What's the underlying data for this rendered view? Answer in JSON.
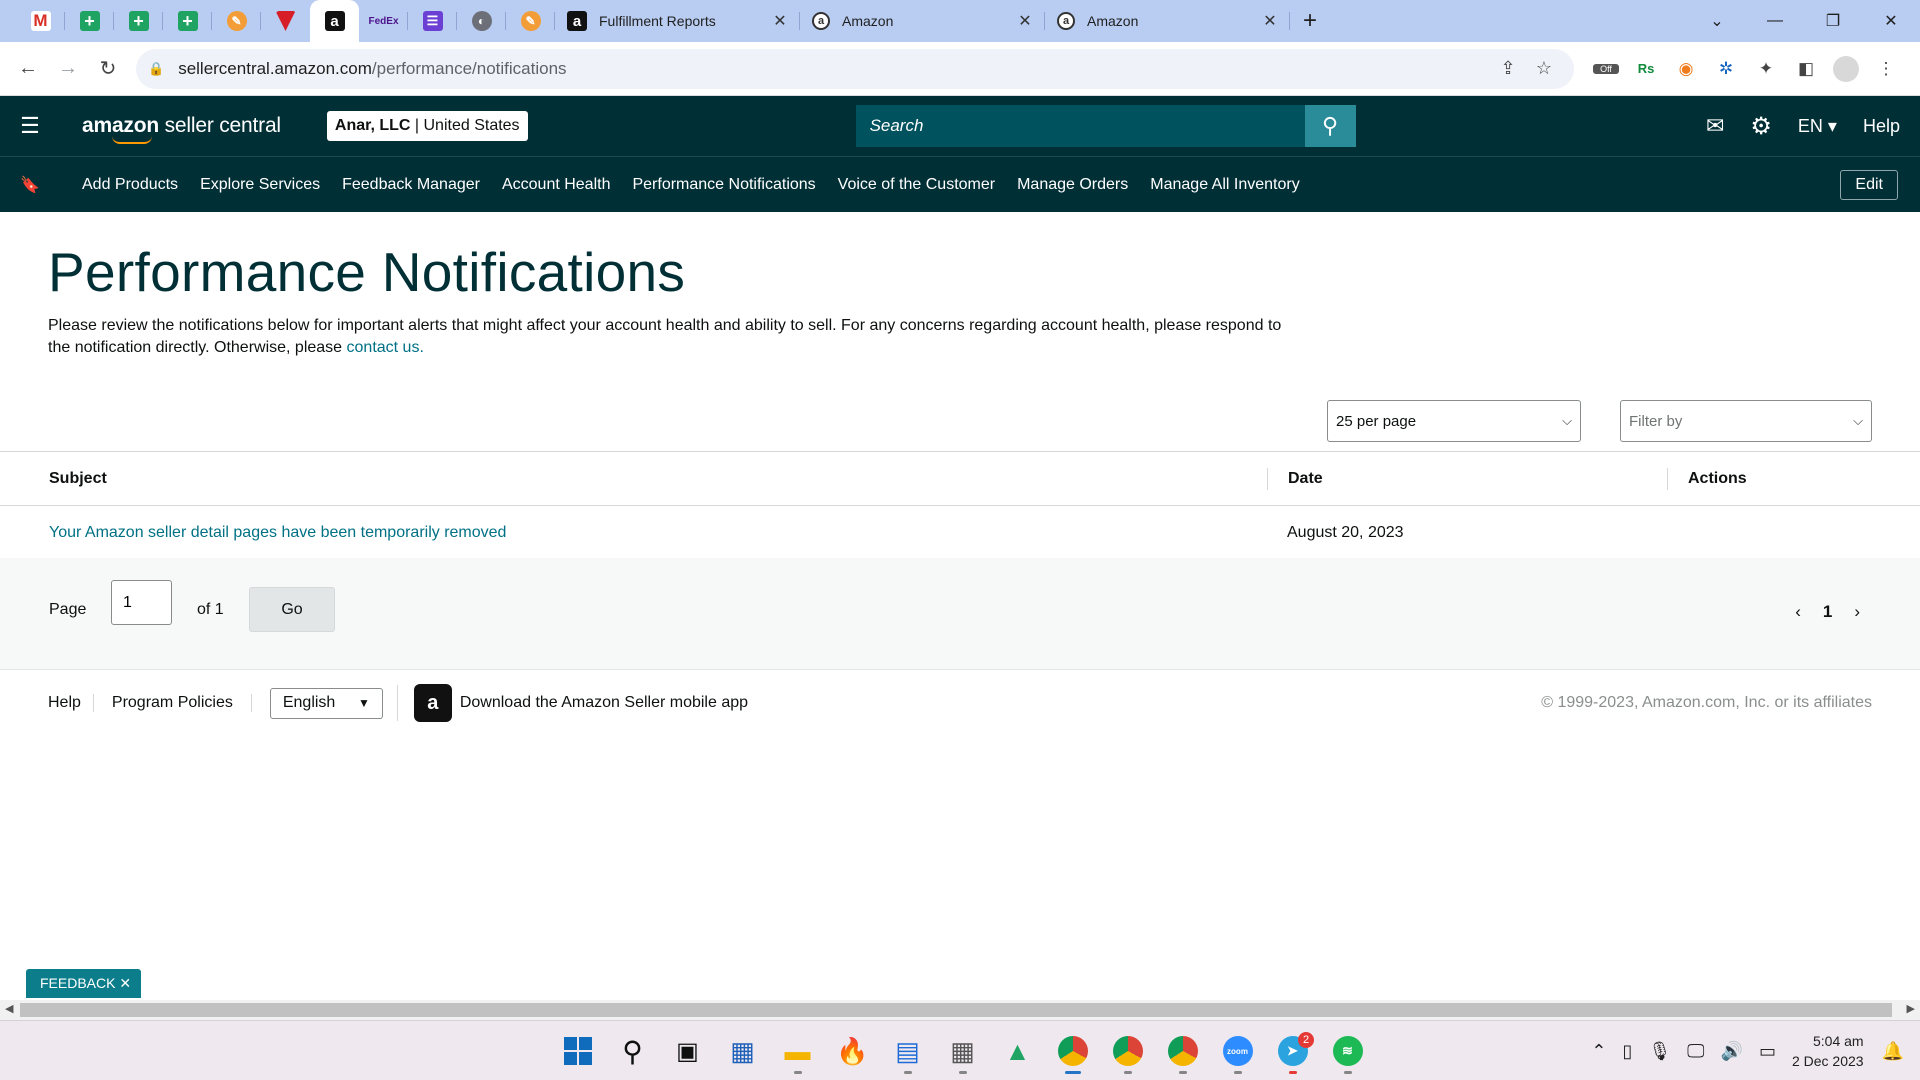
{
  "browser": {
    "pinned_tabs": [
      {
        "icon": "gmail-icon",
        "glyph": "M"
      },
      {
        "icon": "sheets-icon",
        "glyph": "+"
      },
      {
        "icon": "sheets-icon",
        "glyph": "+"
      },
      {
        "icon": "sheets-icon",
        "glyph": "+"
      },
      {
        "icon": "pencil-icon",
        "glyph": "✎"
      },
      {
        "icon": "shield-icon",
        "glyph": ""
      },
      {
        "icon": "amazon-icon",
        "glyph": "a"
      },
      {
        "icon": "fedex-icon",
        "glyph": "FedEx"
      },
      {
        "icon": "list-icon",
        "glyph": "☰"
      },
      {
        "icon": "globe-icon",
        "glyph": "◐"
      },
      {
        "icon": "pencil-icon",
        "glyph": "✎"
      }
    ],
    "tabs": [
      {
        "title": "Fulfillment Reports",
        "icon": "amazon-icon",
        "glyph": "a"
      },
      {
        "title": "Amazon",
        "icon": "amazon-circle-icon",
        "glyph": "a"
      },
      {
        "title": "Amazon",
        "icon": "amazon-circle-icon",
        "glyph": "a"
      }
    ],
    "url_host": "sellercentral.amazon.com",
    "url_path": "/performance/notifications"
  },
  "header": {
    "logo_bold": "amazon",
    "logo_rest": " seller central",
    "account_name": "Anar, LLC",
    "account_sep": " | ",
    "account_region": "United States",
    "search_placeholder": "Search",
    "language": "EN",
    "help": "Help"
  },
  "nav": {
    "links": [
      "Add Products",
      "Explore Services",
      "Feedback Manager",
      "Account Health",
      "Performance Notifications",
      "Voice of the Customer",
      "Manage Orders",
      "Manage All Inventory"
    ],
    "edit": "Edit"
  },
  "main": {
    "title": "Performance Notifications",
    "intro": "Please review the notifications below for important alerts that might affect your account health and ability to sell. For any concerns regarding account health, please respond to the notification directly. Otherwise, please ",
    "contact_link": "contact us.",
    "per_page": "25 per page",
    "filter_placeholder": "Filter by",
    "table": {
      "headers": {
        "subject": "Subject",
        "date": "Date",
        "actions": "Actions"
      },
      "rows": [
        {
          "subject": "Your Amazon seller detail pages have been temporarily removed",
          "date": "August 20, 2023",
          "actions": ""
        }
      ]
    },
    "pagination": {
      "page_label": "Page",
      "page_value": "1",
      "of_label": "of 1",
      "go": "Go",
      "current": "1"
    }
  },
  "footer": {
    "help": "Help",
    "policies": "Program Policies",
    "language": "English",
    "app_text": "Download the Amazon Seller mobile app",
    "copyright": "© 1999-2023, Amazon.com, Inc. or its affiliates"
  },
  "feedback": "FEEDBACK",
  "taskbar": {
    "time": "5:04 am",
    "date": "2 Dec 2023",
    "telegram_badge": "2",
    "zoom_label": "zoom"
  },
  "colors": {
    "header_bg": "#002f36",
    "link": "#007185",
    "search_bg": "#00525e",
    "search_btn": "#2b8c99",
    "feedback_bg": "#0c7d8b"
  }
}
